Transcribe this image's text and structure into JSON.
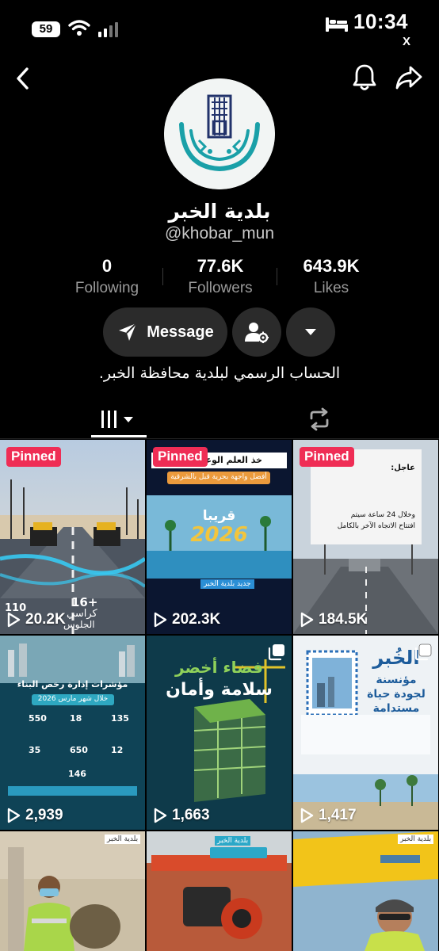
{
  "status_bar": {
    "battery_level": "59",
    "time": "10:34",
    "x_label": "X"
  },
  "profile": {
    "display_name": "بلدية الخبر",
    "username": "@khobar_mun",
    "stats": [
      {
        "value": "0",
        "label": "Following"
      },
      {
        "value": "77.6K",
        "label": "Followers"
      },
      {
        "value": "643.9K",
        "label": "Likes"
      }
    ],
    "message_label": "Message",
    "bio": "الحساب الرسمي لبلدية محافظة الخبر."
  },
  "colors": {
    "background": "#000000",
    "button_bg": "#2b2b2b",
    "pinned_badge": "#ef2d55",
    "logo_teal": "#1aa0a8",
    "logo_navy": "#22336b"
  },
  "videos": [
    {
      "pinned": true,
      "pinned_label": "Pinned",
      "views": "20.2K",
      "caption_1": "+16",
      "caption_2": "كراسي",
      "caption_3": "الجلوس",
      "caption_4": "110"
    },
    {
      "pinned": true,
      "pinned_label": "Pinned",
      "views": "202.3K",
      "caption_1": "خذ العلم الوعد نهاية",
      "caption_2": "أفضل واجهة بحرية قبل بالشرقية",
      "caption_3": "قريبا",
      "caption_4": "2026",
      "caption_5": "جديد بلدية الخبر"
    },
    {
      "pinned": true,
      "pinned_label": "Pinned",
      "views": "184.5K",
      "caption_1": "عاجل:",
      "caption_2": "وخلال 24 ساعة سيتم",
      "caption_3": "افتتاح الاتجاه الآخر بالكامل"
    },
    {
      "pinned": false,
      "views": "2,939",
      "caption_1": "مؤشرات إدارة رخص البناء",
      "caption_2": "خلال شهر مارس 2026",
      "caption_3": "135",
      "caption_4": "18",
      "caption_5": "550",
      "caption_6": "12",
      "caption_7": "650",
      "caption_8": "35",
      "caption_9": "146"
    },
    {
      "pinned": false,
      "views": "1,663",
      "caption_1": "فضاء أخضر",
      "caption_2": "سلامة وأمان"
    },
    {
      "pinned": false,
      "views": "1,417",
      "caption_1": "الخُبر",
      "caption_2": "مؤنسنة",
      "caption_3": "لجودة حياة",
      "caption_4": "مستدامة"
    },
    {
      "pinned": false,
      "views": "",
      "caption_1": "بلدية الخبر"
    },
    {
      "pinned": false,
      "views": "",
      "caption_1": "بلدية الخبر"
    },
    {
      "pinned": false,
      "views": "",
      "caption_1": "بلدية الخبر"
    }
  ]
}
